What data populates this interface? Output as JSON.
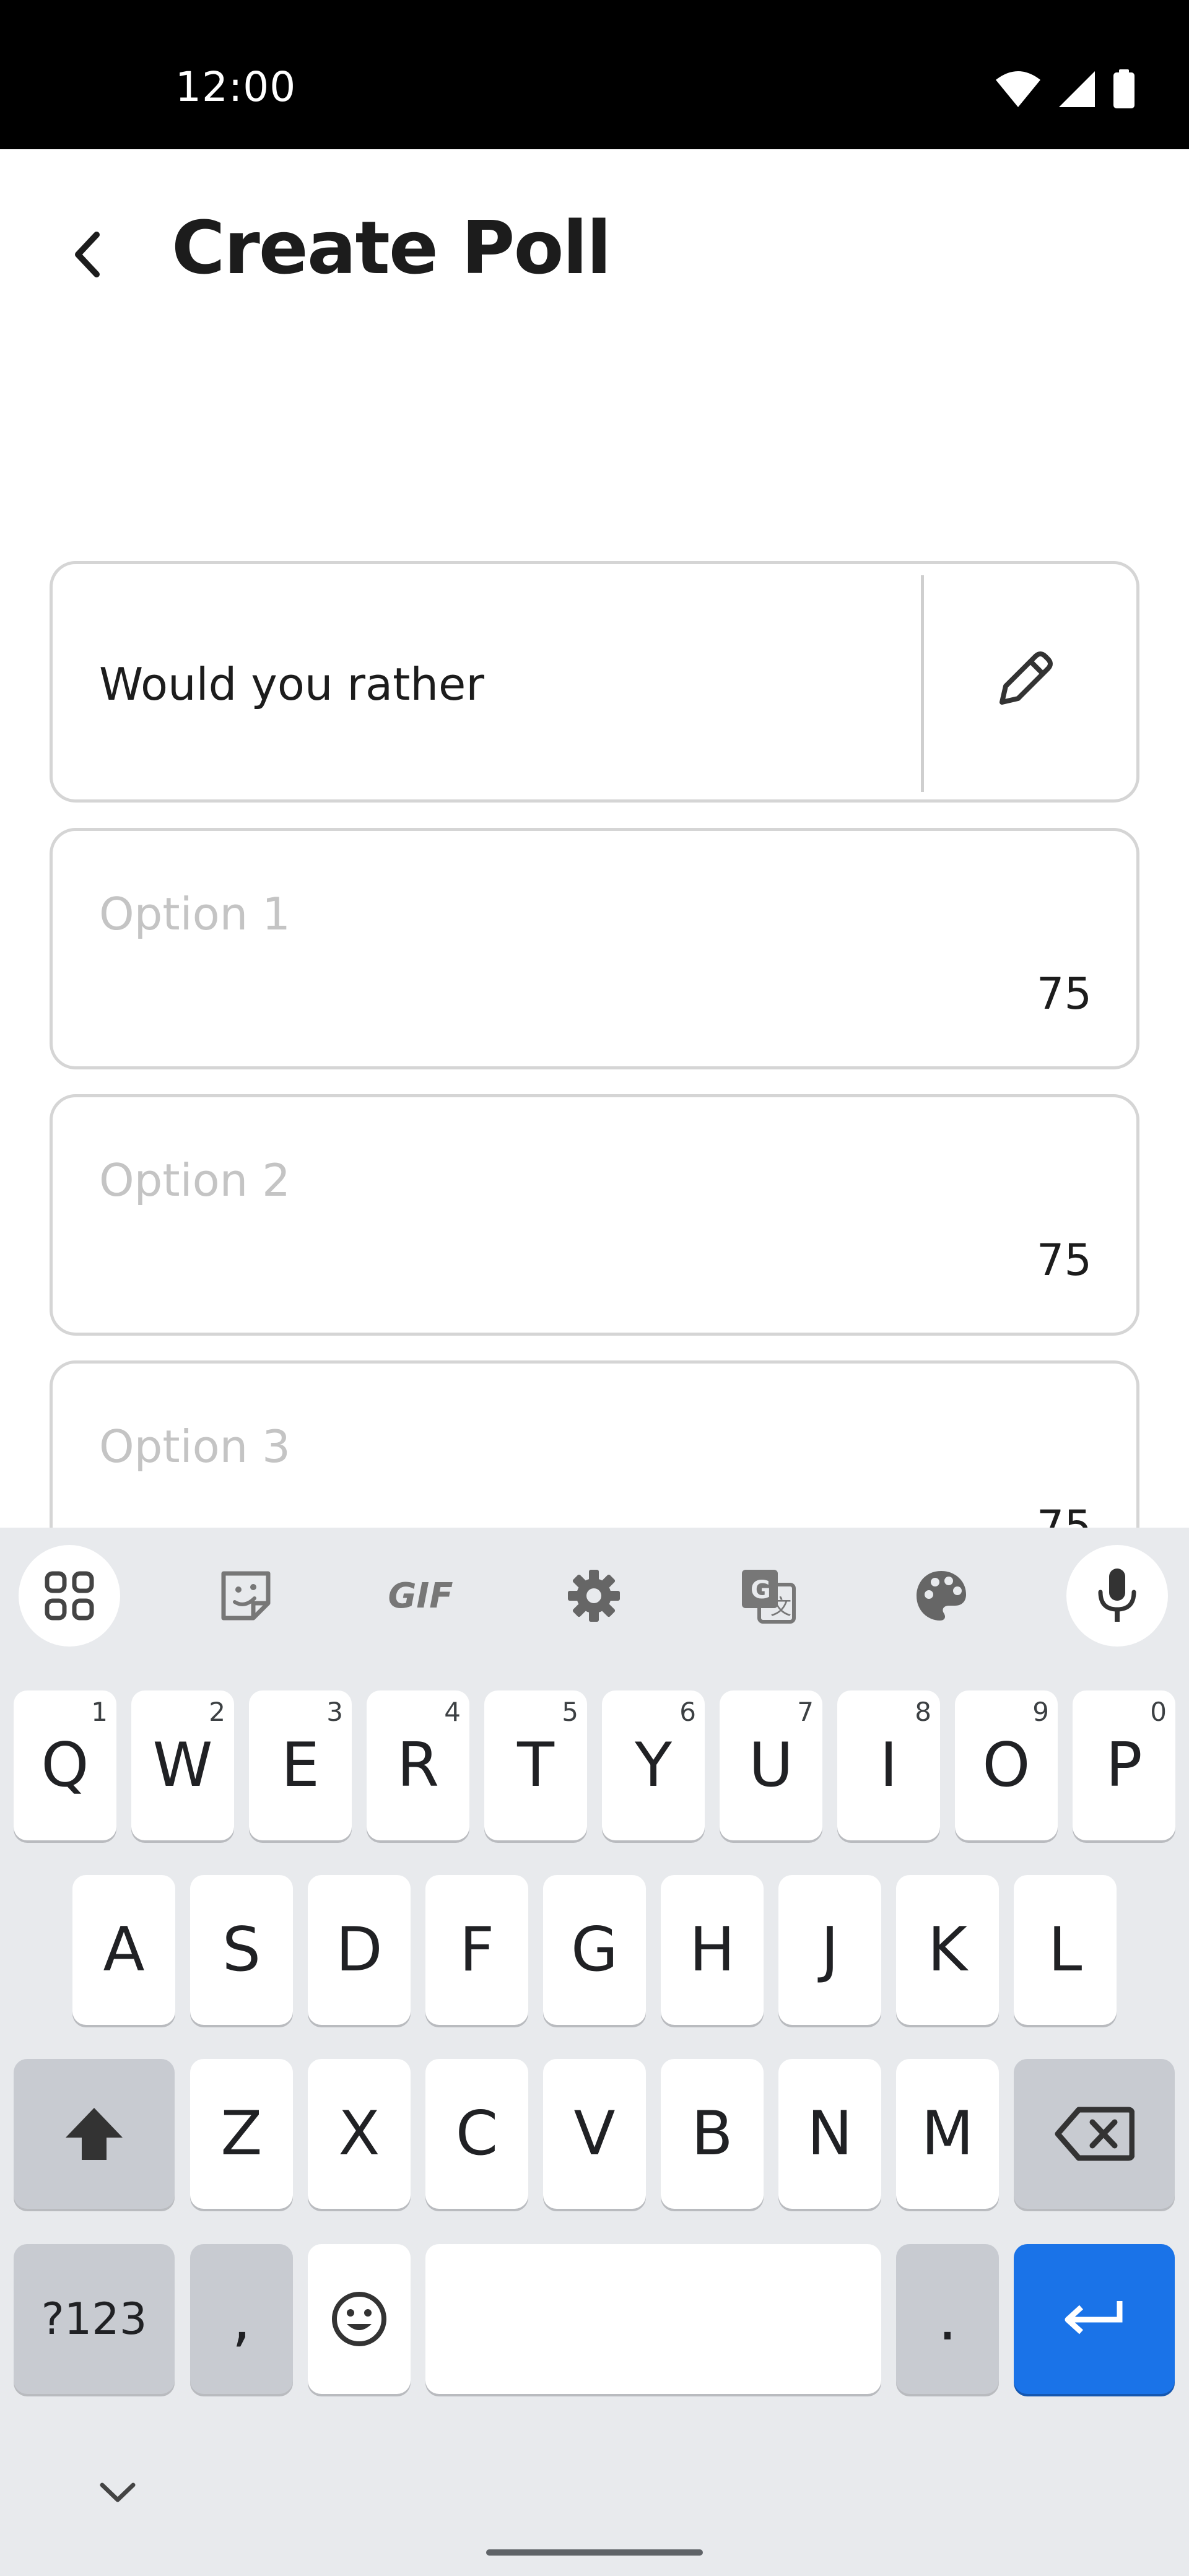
{
  "status_bar": {
    "time": "12:00",
    "icons": [
      "wifi-icon",
      "signal-icon",
      "battery-icon"
    ]
  },
  "app_bar": {
    "title": "Create Poll",
    "back_icon": "back-arrow-icon"
  },
  "question": {
    "value": "Would you rather",
    "edit_icon": "pencil-icon"
  },
  "options": [
    {
      "placeholder": "Option 1",
      "remaining": "75"
    },
    {
      "placeholder": "Option 2",
      "remaining": "75"
    },
    {
      "placeholder": "Option 3",
      "remaining": "75"
    }
  ],
  "keyboard": {
    "toolbar": [
      "apps-grid-icon",
      "sticker-icon",
      "gif-icon",
      "settings-icon",
      "translate-icon",
      "palette-icon",
      "microphone-icon"
    ],
    "toolbar_gif_label": "GIF",
    "row1": [
      {
        "key": "Q",
        "hint": "1"
      },
      {
        "key": "W",
        "hint": "2"
      },
      {
        "key": "E",
        "hint": "3"
      },
      {
        "key": "R",
        "hint": "4"
      },
      {
        "key": "T",
        "hint": "5"
      },
      {
        "key": "Y",
        "hint": "6"
      },
      {
        "key": "U",
        "hint": "7"
      },
      {
        "key": "I",
        "hint": "8"
      },
      {
        "key": "O",
        "hint": "9"
      },
      {
        "key": "P",
        "hint": "0"
      }
    ],
    "row2": [
      "A",
      "S",
      "D",
      "F",
      "G",
      "H",
      "J",
      "K",
      "L"
    ],
    "row3": [
      "Z",
      "X",
      "C",
      "V",
      "B",
      "N",
      "M"
    ],
    "symbols_label": "?123",
    "comma_label": ",",
    "period_label": ".",
    "colors": {
      "enter": "#1a73e8",
      "modifier": "#c8cbd1",
      "background": "#e8eaed"
    }
  }
}
